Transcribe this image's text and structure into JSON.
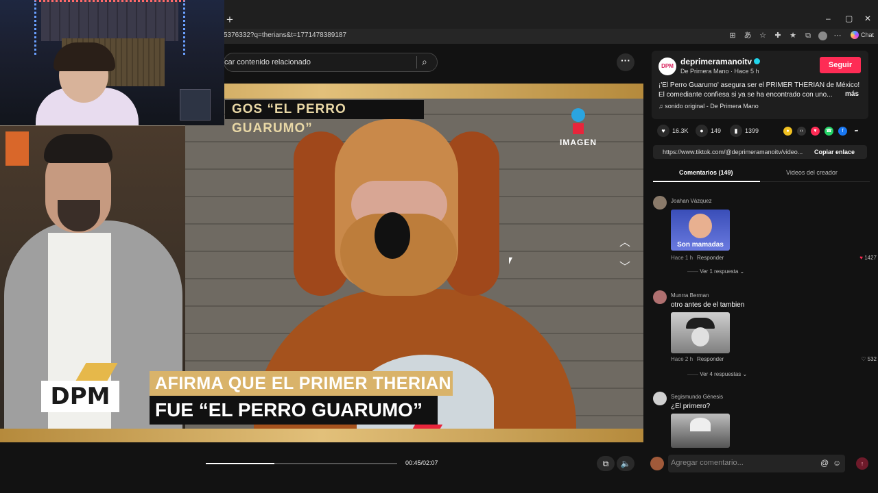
{
  "browser": {
    "new_tab": "+",
    "url": "5376332?q=therians&t=1771478389187",
    "chat_label": "Chat",
    "min": "–",
    "max": "▢",
    "close": "✕"
  },
  "search": {
    "placeholder": "car contenido relacionado"
  },
  "video": {
    "top_caption": "GOS “EL PERRO GUARUMO”",
    "network_logo": "IMAGEN",
    "show_logo": "DPM",
    "caption_line1": "AFIRMA QUE EL PRIMER THERIAN",
    "caption_line2": "FUE “EL PERRO GUARUMO”"
  },
  "player": {
    "time": "00:45/02:07",
    "progress": 0.36
  },
  "author": {
    "avatar_text": "DPM",
    "username": "deprimeramanoitv",
    "subline": "De Primera Mano · Hace 5 h",
    "follow": "Seguir",
    "description": "¡'El Perro Guarumo' asegura ser el PRIMER THERIAN de México! El comediante confiesa si ya se ha encontrado con uno...",
    "more": "más",
    "sound": "♫  sonido original - De Primera Mano"
  },
  "stats": {
    "likes": "16.3K",
    "comments": "149",
    "saves": "1399"
  },
  "link": {
    "url": "https://www.tiktok.com/@deprimeramanoitv/video...",
    "copy": "Copiar enlace"
  },
  "tabs": {
    "comments": "Comentarios (149)",
    "creator": "Videos del creador"
  },
  "comments": [
    {
      "name": "Joahan Vázquez",
      "text": "",
      "image_caption": "Son mamadas",
      "time": "Hace 1 h",
      "reply": "Responder",
      "likes": "1427",
      "replies": "Ver 1 respuesta"
    },
    {
      "name": "Munrra Berman",
      "text": "otro antes de el tambien",
      "time": "Hace 2 h",
      "reply": "Responder",
      "likes": "532",
      "replies": "Ver 4 respuestas"
    },
    {
      "name": "Segismundo Génesis",
      "text": "¿El primero?"
    }
  ],
  "comment_input": {
    "placeholder": "Agregar comentario...",
    "at": "@",
    "emoji": "☺"
  }
}
